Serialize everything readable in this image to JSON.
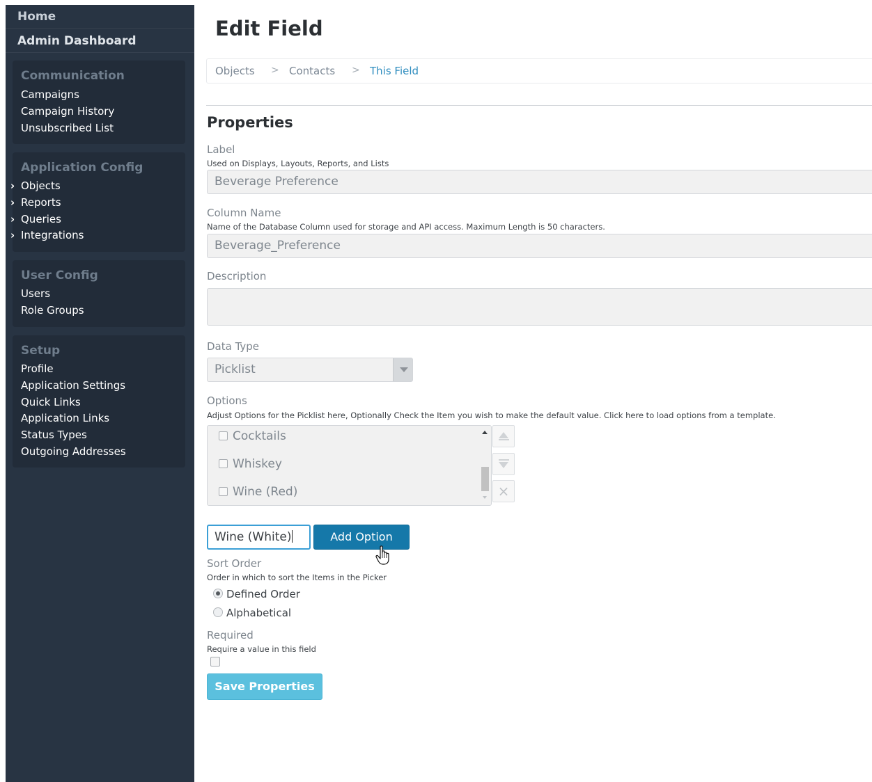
{
  "sidebar": {
    "home": "Home",
    "admin_dashboard": "Admin Dashboard",
    "communication": {
      "title": "Communication",
      "items": [
        "Campaigns",
        "Campaign History",
        "Unsubscribed List"
      ]
    },
    "application_config": {
      "title": "Application Config",
      "items": [
        "Objects",
        "Reports",
        "Queries",
        "Integrations"
      ]
    },
    "user_config": {
      "title": "User Config",
      "items": [
        "Users",
        "Role Groups"
      ]
    },
    "setup": {
      "title": "Setup",
      "items": [
        "Profile",
        "Application Settings",
        "Quick Links",
        "Application Links",
        "Status Types",
        "Outgoing Addresses"
      ]
    },
    "chevron": "›"
  },
  "page": {
    "title": "Edit Field",
    "breadcrumb": [
      "Objects",
      "Contacts",
      "This Field"
    ],
    "breadcrumb_separator": ">"
  },
  "properties": {
    "title": "Properties",
    "label": {
      "name": "Label",
      "help": "Used on Displays, Layouts, Reports, and Lists",
      "value": "Beverage Preference"
    },
    "column_name": {
      "name": "Column Name",
      "help": "Name of the Database Column used for storage and API access. Maximum Length is 50 characters.",
      "value": "Beverage_Preference"
    },
    "description": {
      "name": "Description",
      "value": ""
    },
    "data_type": {
      "name": "Data Type",
      "value": "Picklist"
    },
    "options": {
      "name": "Options",
      "help": "Adjust Options for the Picklist here, Optionally Check the Item you wish to make the default value. Click here to load options from a template.",
      "items": [
        {
          "label": "Cocktails",
          "checked": false
        },
        {
          "label": "Whiskey",
          "checked": false
        },
        {
          "label": "Wine (Red)",
          "checked": false
        }
      ],
      "new_option_value": "Wine (White)",
      "add_button": "Add Option"
    },
    "sort_order": {
      "name": "Sort Order",
      "help": "Order in which to sort the Items in the Picker",
      "choices": [
        "Defined Order",
        "Alphabetical"
      ],
      "selected": "Defined Order"
    },
    "required": {
      "name": "Required",
      "help": "Require a value in this field",
      "checked": false
    },
    "save_button": "Save Properties"
  },
  "icons": {
    "move_up": "move-up-icon",
    "move_down": "move-down-icon",
    "remove": "close-icon",
    "cursor": "hand-pointer-icon"
  },
  "colors": {
    "sidebar_bg": "#283443",
    "panel_bg": "#222c39",
    "link_active": "#2f8dbf",
    "primary_button": "#1578a9",
    "save_button": "#5bc0de"
  }
}
